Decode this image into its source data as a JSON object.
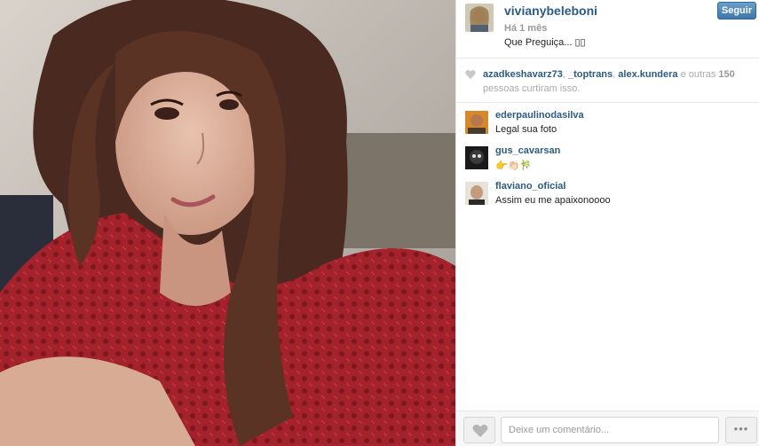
{
  "post": {
    "username": "vivianybeleboni",
    "time_ago": "Há 1 mês",
    "caption": "Que Preguiça... ▯▯",
    "follow_label": "Seguir"
  },
  "likes": {
    "users": [
      "azadkeshavarz73",
      "_toptrans",
      "alex.kundera"
    ],
    "others_prefix": "e outras",
    "others_count": "150",
    "suffix": "pessoas curtiram isso."
  },
  "comments": [
    {
      "username": "ederpaulinodasilva",
      "text": "Legal sua foto"
    },
    {
      "username": "gus_cavarsan",
      "text": "👉👏🏻🎋"
    },
    {
      "username": "flaviano_oficial",
      "text": "Assim eu me apaixonoooo"
    }
  ],
  "footer": {
    "comment_placeholder": "Deixe um comentário...",
    "more_label": "•••"
  },
  "colors": {
    "username": "#2a5b83",
    "follow_button": "#3e76a8",
    "dress": "#a3222b"
  },
  "icons": {
    "like": "heart-icon",
    "more": "ellipsis-icon"
  }
}
